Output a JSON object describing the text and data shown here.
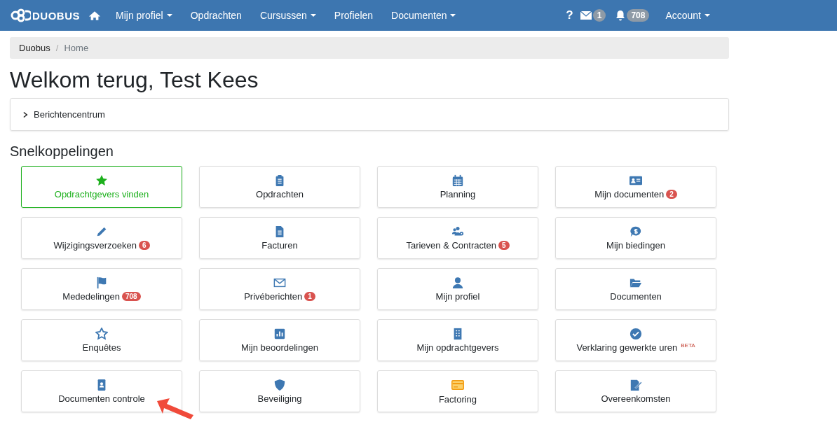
{
  "navbar": {
    "brand": "DUOBUS",
    "items": [
      {
        "label": "Mijn profiel",
        "dropdown": true
      },
      {
        "label": "Opdrachten",
        "dropdown": false
      },
      {
        "label": "Cursussen",
        "dropdown": true
      },
      {
        "label": "Profielen",
        "dropdown": false
      },
      {
        "label": "Documenten",
        "dropdown": true
      }
    ],
    "help": "?",
    "messages_count": "1",
    "notifications_count": "708",
    "account": "Account"
  },
  "breadcrumb_separator": "/",
  "breadcrumb": [
    {
      "label": "Duobus",
      "current": false
    },
    {
      "label": "Home",
      "current": true
    }
  ],
  "heading": "Welkom terug, Test Kees",
  "message_center": {
    "label": "Berichtencentrum",
    "expanded": false
  },
  "shortcuts_title": "Snelkoppelingen",
  "shortcuts": [
    {
      "kind": "star",
      "label": "Opdrachtgevers vinden",
      "highlighted": true
    },
    {
      "kind": "clipboard",
      "label": "Opdrachten",
      "highlighted": false
    },
    {
      "kind": "calendar",
      "label": "Planning",
      "highlighted": false
    },
    {
      "kind": "idcard",
      "label": "Mijn documenten",
      "badge": "2",
      "highlighted": false
    },
    {
      "kind": "pencil",
      "label": "Wijzigingsverzoeken",
      "badge": "6",
      "highlighted": false
    },
    {
      "kind": "file",
      "label": "Facturen",
      "highlighted": false
    },
    {
      "kind": "users",
      "label": "Tarieven & Contracten",
      "badge": "5",
      "highlighted": false
    },
    {
      "kind": "bid",
      "label": "Mijn biedingen",
      "highlighted": false
    },
    {
      "kind": "flag",
      "label": "Mededelingen",
      "badge": "708",
      "highlighted": false
    },
    {
      "kind": "envelope",
      "label": "Privéberichten",
      "badge": "1",
      "highlighted": false
    },
    {
      "kind": "user",
      "label": "Mijn profiel",
      "highlighted": false
    },
    {
      "kind": "folder",
      "label": "Documenten",
      "highlighted": false
    },
    {
      "kind": "staroutline",
      "label": "Enquêtes",
      "highlighted": false
    },
    {
      "kind": "chart",
      "label": "Mijn beoordelingen",
      "highlighted": false
    },
    {
      "kind": "building",
      "label": "Mijn opdrachtgevers",
      "highlighted": false
    },
    {
      "kind": "check",
      "label": "Verklaring gewerkte uren",
      "sup": "BETA",
      "highlighted": false
    },
    {
      "kind": "badge",
      "label": "Documenten controle",
      "highlighted": false,
      "pointed": true
    },
    {
      "kind": "shield",
      "label": "Beveiliging",
      "highlighted": false
    },
    {
      "kind": "card",
      "label": "Factoring",
      "highlighted": false
    },
    {
      "kind": "sign",
      "label": "Overeenkomsten",
      "highlighted": false
    }
  ]
}
